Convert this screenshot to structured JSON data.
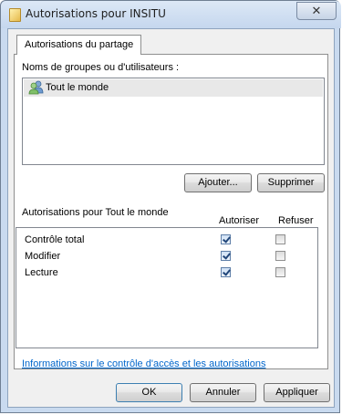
{
  "window": {
    "title": "Autorisations pour INSITU",
    "close_label": "✕"
  },
  "tabs": [
    {
      "label": "Autorisations du partage"
    }
  ],
  "groups": {
    "label": "Noms de groupes ou d'utilisateurs :",
    "items": [
      {
        "label": "Tout le monde",
        "icon": "users-icon",
        "selected": true
      }
    ]
  },
  "buttons": {
    "add": "Ajouter...",
    "remove": "Supprimer",
    "ok": "OK",
    "cancel": "Annuler",
    "apply": "Appliquer"
  },
  "permissions": {
    "title": "Autorisations pour Tout le monde",
    "col_allow": "Autoriser",
    "col_deny": "Refuser",
    "rows": [
      {
        "name": "Contrôle total",
        "allow": true,
        "deny": false
      },
      {
        "name": "Modifier",
        "allow": true,
        "deny": false
      },
      {
        "name": "Lecture",
        "allow": true,
        "deny": false
      }
    ]
  },
  "help_link": "Informations sur le contrôle d'accès et les autorisations",
  "colors": {
    "link": "#0066cc",
    "selection": "#e8e8e8"
  }
}
